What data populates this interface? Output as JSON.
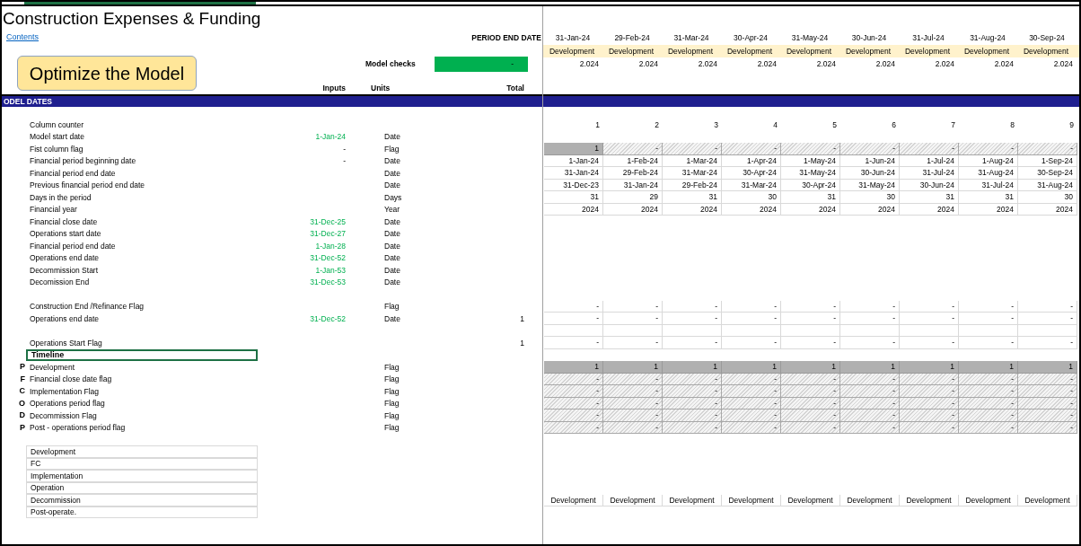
{
  "title": "Construction Expenses & Funding",
  "contents_link": "Contents",
  "optimize_button": "Optimize the Model",
  "period_end_label": "PERIOD END DATE",
  "model_checks": {
    "label": "Model checks",
    "value": "-"
  },
  "headers": {
    "inputs": "Inputs",
    "units": "Units",
    "total": "Total"
  },
  "periods": [
    {
      "end_date": "31-Jan-24",
      "phase": "Development",
      "year_value": "2.024"
    },
    {
      "end_date": "29-Feb-24",
      "phase": "Development",
      "year_value": "2.024"
    },
    {
      "end_date": "31-Mar-24",
      "phase": "Development",
      "year_value": "2.024"
    },
    {
      "end_date": "30-Apr-24",
      "phase": "Development",
      "year_value": "2.024"
    },
    {
      "end_date": "31-May-24",
      "phase": "Development",
      "year_value": "2.024"
    },
    {
      "end_date": "30-Jun-24",
      "phase": "Development",
      "year_value": "2.024"
    },
    {
      "end_date": "31-Jul-24",
      "phase": "Development",
      "year_value": "2.024"
    },
    {
      "end_date": "31-Aug-24",
      "phase": "Development",
      "year_value": "2.024"
    },
    {
      "end_date": "30-Sep-24",
      "phase": "Development",
      "year_value": "2.024"
    }
  ],
  "section_title": "ODEL DATES",
  "rows": [
    {
      "kind": "data",
      "label": "Column counter",
      "selected": false,
      "cells": {
        "kind": "none",
        "values": [
          "1",
          "2",
          "3",
          "4",
          "5",
          "6",
          "7",
          "8",
          "9"
        ]
      }
    },
    {
      "kind": "data",
      "label": "Model start date",
      "selected": false,
      "input": {
        "text": "1-Jan-24",
        "kind": "hardcoded"
      },
      "unit": "Date"
    },
    {
      "kind": "data",
      "label": "Fist column flag",
      "selected": false,
      "input": {
        "text": "-",
        "kind": "formula"
      },
      "unit": "Flag",
      "cells": {
        "kind": "flag-first",
        "values": [
          "1",
          "-",
          "-",
          "-",
          "-",
          "-",
          "-",
          "-",
          "-"
        ]
      }
    },
    {
      "kind": "data",
      "label": "Financial period beginning date",
      "selected": false,
      "input": {
        "text": "-",
        "kind": "formula"
      },
      "unit": "Date",
      "cells": {
        "kind": "bordered",
        "values": [
          "1-Jan-24",
          "1-Feb-24",
          "1-Mar-24",
          "1-Apr-24",
          "1-May-24",
          "1-Jun-24",
          "1-Jul-24",
          "1-Aug-24",
          "1-Sep-24"
        ]
      }
    },
    {
      "kind": "data",
      "label": "Financial period end date",
      "selected": false,
      "unit": "Date",
      "cells": {
        "kind": "bordered",
        "values": [
          "31-Jan-24",
          "29-Feb-24",
          "31-Mar-24",
          "30-Apr-24",
          "31-May-24",
          "30-Jun-24",
          "31-Jul-24",
          "31-Aug-24",
          "30-Sep-24"
        ]
      }
    },
    {
      "kind": "data",
      "label": "Previous financial period end date",
      "selected": false,
      "unit": "Date",
      "cells": {
        "kind": "bordered",
        "values": [
          "31-Dec-23",
          "31-Jan-24",
          "29-Feb-24",
          "31-Mar-24",
          "30-Apr-24",
          "31-May-24",
          "30-Jun-24",
          "31-Jul-24",
          "31-Aug-24"
        ]
      }
    },
    {
      "kind": "data",
      "label": "Days in the period",
      "selected": false,
      "unit": "Days",
      "cells": {
        "kind": "bordered",
        "values": [
          "31",
          "29",
          "31",
          "30",
          "31",
          "30",
          "31",
          "31",
          "30"
        ]
      }
    },
    {
      "kind": "data",
      "label": "Financial year",
      "selected": false,
      "unit": "Year",
      "cells": {
        "kind": "bordered",
        "values": [
          "2024",
          "2024",
          "2024",
          "2024",
          "2024",
          "2024",
          "2024",
          "2024",
          "2024"
        ]
      }
    },
    {
      "kind": "data",
      "label": "Financial close date",
      "selected": false,
      "input": {
        "text": "31-Dec-25",
        "kind": "hardcoded"
      },
      "unit": "Date"
    },
    {
      "kind": "data",
      "label": "Operations start date",
      "selected": false,
      "input": {
        "text": "31-Dec-27",
        "kind": "hardcoded"
      },
      "unit": "Date"
    },
    {
      "kind": "data",
      "label": "Financial period end date",
      "selected": false,
      "input": {
        "text": "1-Jan-28",
        "kind": "hardcoded"
      },
      "unit": "Date"
    },
    {
      "kind": "data",
      "label": "Operations end date",
      "selected": false,
      "input": {
        "text": "31-Dec-52",
        "kind": "hardcoded"
      },
      "unit": "Date"
    },
    {
      "kind": "data",
      "label": "Decommission Start",
      "selected": false,
      "input": {
        "text": "1-Jan-53",
        "kind": "hardcoded"
      },
      "unit": "Date"
    },
    {
      "kind": "data",
      "label": "Decomission End",
      "selected": false,
      "input": {
        "text": "31-Dec-53",
        "kind": "hardcoded"
      },
      "unit": "Date"
    },
    {
      "kind": "spacer"
    },
    {
      "kind": "data",
      "label": "Construction End /Refinance Flag",
      "selected": false,
      "unit": "Flag",
      "cells": {
        "kind": "bordered",
        "values": [
          "-",
          "-",
          "-",
          "-",
          "-",
          "-",
          "-",
          "-",
          "-"
        ]
      }
    },
    {
      "kind": "data",
      "label": "Operations end date",
      "selected": false,
      "input": {
        "text": "31-Dec-52",
        "kind": "hardcoded"
      },
      "unit": "Date",
      "total": "1",
      "cells": {
        "kind": "bordered",
        "values": [
          "-",
          "-",
          "-",
          "-",
          "-",
          "-",
          "-",
          "-",
          "-"
        ]
      }
    },
    {
      "kind": "grid-spacer"
    },
    {
      "kind": "data",
      "label": "Operations Start Flag",
      "selected": false,
      "total": "1",
      "cells": {
        "kind": "bordered",
        "values": [
          "-",
          "-",
          "-",
          "-",
          "-",
          "-",
          "-",
          "-",
          "-"
        ]
      }
    },
    {
      "kind": "heading",
      "label": "Timeline",
      "selected": true
    },
    {
      "kind": "data",
      "prefix": "P",
      "label": "Development",
      "selected": false,
      "unit": "Flag",
      "cells": {
        "kind": "grey",
        "values": [
          "1",
          "1",
          "1",
          "1",
          "1",
          "1",
          "1",
          "1",
          "1"
        ]
      }
    },
    {
      "kind": "data",
      "prefix": "F",
      "label": "Financial close date flag",
      "selected": false,
      "unit": "Flag",
      "cells": {
        "kind": "hatched",
        "values": [
          "-",
          "-",
          "-",
          "-",
          "-",
          "-",
          "-",
          "-",
          "-"
        ]
      }
    },
    {
      "kind": "data",
      "prefix": "C",
      "label": "Implementation Flag",
      "selected": false,
      "unit": "Flag",
      "cells": {
        "kind": "hatched",
        "values": [
          "-",
          "-",
          "-",
          "-",
          "-",
          "-",
          "-",
          "-",
          "-"
        ]
      }
    },
    {
      "kind": "data",
      "prefix": "O",
      "label": "Operations period flag",
      "selected": false,
      "unit": "Flag",
      "cells": {
        "kind": "hatched",
        "values": [
          "-",
          "-",
          "-",
          "-",
          "-",
          "-",
          "-",
          "-",
          "-"
        ]
      }
    },
    {
      "kind": "data",
      "prefix": "D",
      "label": "Decommission Flag",
      "selected": false,
      "unit": "Flag",
      "cells": {
        "kind": "hatched",
        "values": [
          "-",
          "-",
          "-",
          "-",
          "-",
          "-",
          "-",
          "-",
          "-"
        ]
      }
    },
    {
      "kind": "data",
      "prefix": "P",
      "label": "Post - operations period flag",
      "selected": false,
      "unit": "Flag",
      "cells": {
        "kind": "hatched",
        "values": [
          "-",
          "-",
          "-",
          "-",
          "-",
          "-",
          "-",
          "-",
          "-"
        ]
      }
    },
    {
      "kind": "spacer"
    },
    {
      "kind": "legend",
      "label": "Development",
      "selected": false
    },
    {
      "kind": "legend",
      "label": "FC",
      "selected": false
    },
    {
      "kind": "legend",
      "label": "Implementation",
      "selected": false
    },
    {
      "kind": "legend",
      "label": "Operation",
      "selected": false
    },
    {
      "kind": "legend",
      "label": "Decommission",
      "selected": false,
      "cells": {
        "kind": "bordered-center",
        "values": [
          "Development",
          "Development",
          "Development",
          "Development",
          "Development",
          "Development",
          "Development",
          "Development",
          "Development"
        ]
      }
    },
    {
      "kind": "legend",
      "label": "Post-operate.",
      "selected": false
    }
  ]
}
